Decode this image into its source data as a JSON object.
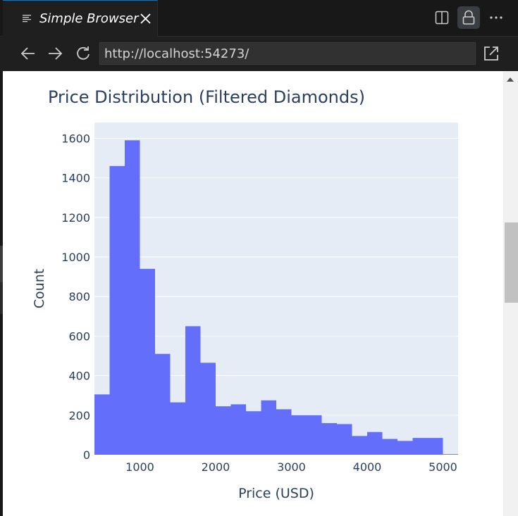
{
  "tab": {
    "title": "Simple Browser"
  },
  "navbar": {
    "url": "http://localhost:54273/"
  },
  "icons": {
    "tab": "preview-icon",
    "close": "close-icon",
    "split": "split-editor-icon",
    "lock": "lock-icon",
    "more": "more-actions-icon",
    "back": "arrow-left-icon",
    "forward": "arrow-right-icon",
    "reload": "refresh-icon",
    "open_external": "link-external-icon"
  },
  "colors": {
    "bar": "#636efa",
    "plot_bg": "#e5ecf6",
    "text": "#2a3f5f",
    "tab_accent": "#0078d4"
  },
  "chart_data": {
    "type": "bar",
    "title": "Price Distribution (Filtered Diamonds)",
    "xlabel": "Price (USD)",
    "ylabel": "Count",
    "xlim": [
      400,
      5200
    ],
    "ylim": [
      0,
      1680
    ],
    "xticks": [
      "1000",
      "2000",
      "3000",
      "4000",
      "5000"
    ],
    "yticks": [
      "0",
      "200",
      "400",
      "600",
      "800",
      "1000",
      "1200",
      "1400",
      "1600"
    ],
    "bin_width": 200,
    "bin_starts": [
      400,
      600,
      800,
      1000,
      1200,
      1400,
      1600,
      1800,
      2000,
      2200,
      2400,
      2600,
      2800,
      3000,
      3200,
      3400,
      3600,
      3800,
      4000,
      4200,
      4400,
      4600,
      4800,
      5000
    ],
    "values": [
      305,
      1460,
      1590,
      940,
      510,
      265,
      650,
      465,
      245,
      255,
      220,
      275,
      230,
      200,
      200,
      160,
      155,
      95,
      115,
      80,
      70,
      85,
      85,
      3
    ],
    "grid": true,
    "legend": "none"
  }
}
